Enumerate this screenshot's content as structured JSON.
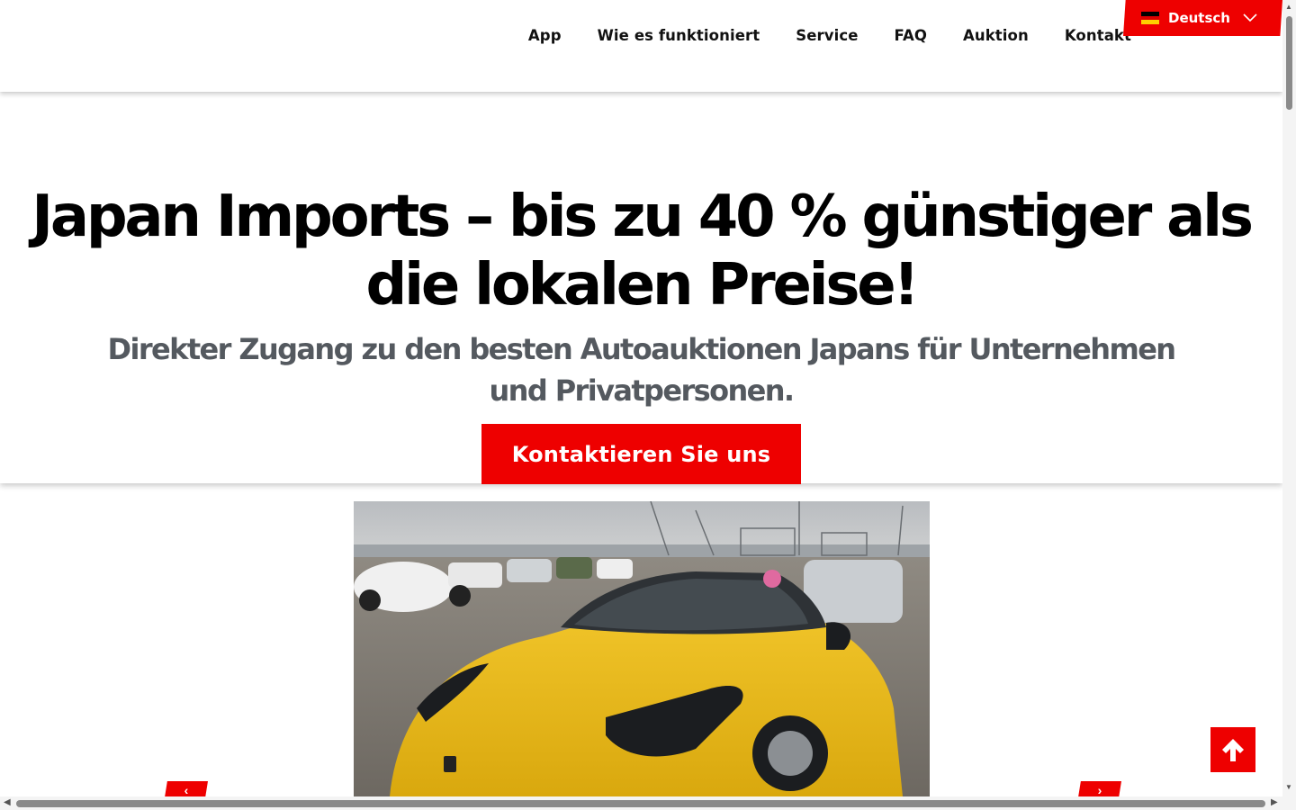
{
  "header": {
    "nav": [
      {
        "label": "App"
      },
      {
        "label": "Wie es funktioniert"
      },
      {
        "label": "Service"
      },
      {
        "label": "FAQ"
      },
      {
        "label": "Auktion"
      },
      {
        "label": "Kontakt"
      }
    ],
    "language": {
      "label": "Deutsch",
      "flag_icon": "germany-flag-icon"
    }
  },
  "hero": {
    "title": "Japan Imports – bis zu 40 % günstiger als die lokalen Preise!",
    "subtitle": "Direkter Zugang zu den besten Autoauktionen Japans für Unternehmen und Privatpersonen.",
    "cta_label": "Kontaktieren Sie uns"
  },
  "carousel": {
    "image_icon": "yellow-sports-car-photo",
    "prev_icon": "arrow-left-icon",
    "next_icon": "arrow-right-icon"
  },
  "scroll_to_top": {
    "icon": "arrow-up-icon"
  },
  "colors": {
    "accent": "#ee0000",
    "subtitle_text": "#54595f",
    "nav_text": "#111111"
  }
}
